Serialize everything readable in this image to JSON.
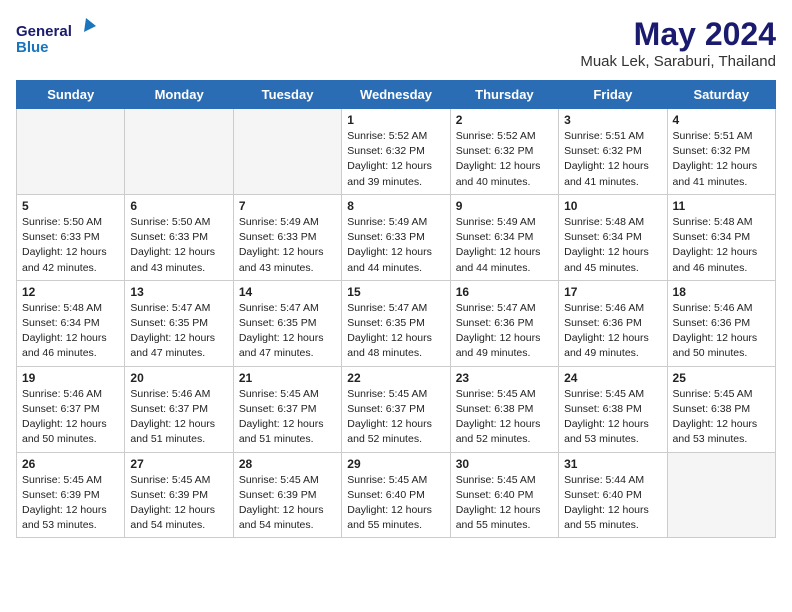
{
  "header": {
    "logo_line1": "General",
    "logo_line2": "Blue",
    "month_year": "May 2024",
    "location": "Muak Lek, Saraburi, Thailand"
  },
  "days_of_week": [
    "Sunday",
    "Monday",
    "Tuesday",
    "Wednesday",
    "Thursday",
    "Friday",
    "Saturday"
  ],
  "weeks": [
    [
      {
        "num": "",
        "info": "",
        "empty": true
      },
      {
        "num": "",
        "info": "",
        "empty": true
      },
      {
        "num": "",
        "info": "",
        "empty": true
      },
      {
        "num": "1",
        "info": "Sunrise: 5:52 AM\nSunset: 6:32 PM\nDaylight: 12 hours\nand 39 minutes."
      },
      {
        "num": "2",
        "info": "Sunrise: 5:52 AM\nSunset: 6:32 PM\nDaylight: 12 hours\nand 40 minutes."
      },
      {
        "num": "3",
        "info": "Sunrise: 5:51 AM\nSunset: 6:32 PM\nDaylight: 12 hours\nand 41 minutes."
      },
      {
        "num": "4",
        "info": "Sunrise: 5:51 AM\nSunset: 6:32 PM\nDaylight: 12 hours\nand 41 minutes."
      }
    ],
    [
      {
        "num": "5",
        "info": "Sunrise: 5:50 AM\nSunset: 6:33 PM\nDaylight: 12 hours\nand 42 minutes."
      },
      {
        "num": "6",
        "info": "Sunrise: 5:50 AM\nSunset: 6:33 PM\nDaylight: 12 hours\nand 43 minutes."
      },
      {
        "num": "7",
        "info": "Sunrise: 5:49 AM\nSunset: 6:33 PM\nDaylight: 12 hours\nand 43 minutes."
      },
      {
        "num": "8",
        "info": "Sunrise: 5:49 AM\nSunset: 6:33 PM\nDaylight: 12 hours\nand 44 minutes."
      },
      {
        "num": "9",
        "info": "Sunrise: 5:49 AM\nSunset: 6:34 PM\nDaylight: 12 hours\nand 44 minutes."
      },
      {
        "num": "10",
        "info": "Sunrise: 5:48 AM\nSunset: 6:34 PM\nDaylight: 12 hours\nand 45 minutes."
      },
      {
        "num": "11",
        "info": "Sunrise: 5:48 AM\nSunset: 6:34 PM\nDaylight: 12 hours\nand 46 minutes."
      }
    ],
    [
      {
        "num": "12",
        "info": "Sunrise: 5:48 AM\nSunset: 6:34 PM\nDaylight: 12 hours\nand 46 minutes."
      },
      {
        "num": "13",
        "info": "Sunrise: 5:47 AM\nSunset: 6:35 PM\nDaylight: 12 hours\nand 47 minutes."
      },
      {
        "num": "14",
        "info": "Sunrise: 5:47 AM\nSunset: 6:35 PM\nDaylight: 12 hours\nand 47 minutes."
      },
      {
        "num": "15",
        "info": "Sunrise: 5:47 AM\nSunset: 6:35 PM\nDaylight: 12 hours\nand 48 minutes."
      },
      {
        "num": "16",
        "info": "Sunrise: 5:47 AM\nSunset: 6:36 PM\nDaylight: 12 hours\nand 49 minutes."
      },
      {
        "num": "17",
        "info": "Sunrise: 5:46 AM\nSunset: 6:36 PM\nDaylight: 12 hours\nand 49 minutes."
      },
      {
        "num": "18",
        "info": "Sunrise: 5:46 AM\nSunset: 6:36 PM\nDaylight: 12 hours\nand 50 minutes."
      }
    ],
    [
      {
        "num": "19",
        "info": "Sunrise: 5:46 AM\nSunset: 6:37 PM\nDaylight: 12 hours\nand 50 minutes."
      },
      {
        "num": "20",
        "info": "Sunrise: 5:46 AM\nSunset: 6:37 PM\nDaylight: 12 hours\nand 51 minutes."
      },
      {
        "num": "21",
        "info": "Sunrise: 5:45 AM\nSunset: 6:37 PM\nDaylight: 12 hours\nand 51 minutes."
      },
      {
        "num": "22",
        "info": "Sunrise: 5:45 AM\nSunset: 6:37 PM\nDaylight: 12 hours\nand 52 minutes."
      },
      {
        "num": "23",
        "info": "Sunrise: 5:45 AM\nSunset: 6:38 PM\nDaylight: 12 hours\nand 52 minutes."
      },
      {
        "num": "24",
        "info": "Sunrise: 5:45 AM\nSunset: 6:38 PM\nDaylight: 12 hours\nand 53 minutes."
      },
      {
        "num": "25",
        "info": "Sunrise: 5:45 AM\nSunset: 6:38 PM\nDaylight: 12 hours\nand 53 minutes."
      }
    ],
    [
      {
        "num": "26",
        "info": "Sunrise: 5:45 AM\nSunset: 6:39 PM\nDaylight: 12 hours\nand 53 minutes."
      },
      {
        "num": "27",
        "info": "Sunrise: 5:45 AM\nSunset: 6:39 PM\nDaylight: 12 hours\nand 54 minutes."
      },
      {
        "num": "28",
        "info": "Sunrise: 5:45 AM\nSunset: 6:39 PM\nDaylight: 12 hours\nand 54 minutes."
      },
      {
        "num": "29",
        "info": "Sunrise: 5:45 AM\nSunset: 6:40 PM\nDaylight: 12 hours\nand 55 minutes."
      },
      {
        "num": "30",
        "info": "Sunrise: 5:45 AM\nSunset: 6:40 PM\nDaylight: 12 hours\nand 55 minutes."
      },
      {
        "num": "31",
        "info": "Sunrise: 5:44 AM\nSunset: 6:40 PM\nDaylight: 12 hours\nand 55 minutes."
      },
      {
        "num": "",
        "info": "",
        "empty": true
      }
    ]
  ]
}
